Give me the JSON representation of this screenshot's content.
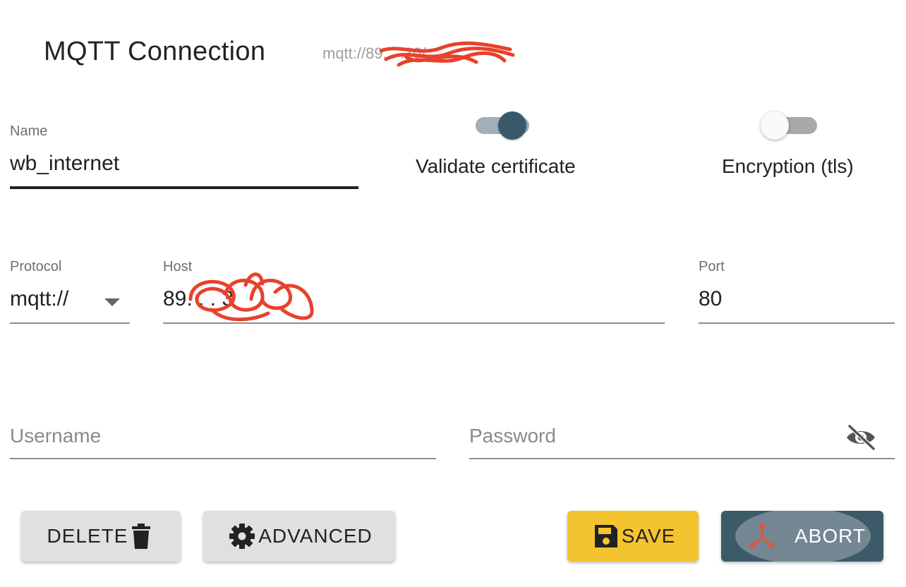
{
  "header": {
    "title": "MQTT Connection",
    "url": "mqtt://89.    .     .30/"
  },
  "name_field": {
    "label": "Name",
    "value": "wb_internet"
  },
  "toggles": {
    "validate_certificate": {
      "label": "Validate certificate",
      "checked": true
    },
    "encryption": {
      "label": "Encryption (tls)",
      "checked": false
    }
  },
  "protocol": {
    "label": "Protocol",
    "value": "mqtt://"
  },
  "host": {
    "label": "Host",
    "value": "89.   .   .   3"
  },
  "port": {
    "label": "Port",
    "value": "80"
  },
  "username": {
    "placeholder": "Username"
  },
  "password": {
    "placeholder": "Password"
  },
  "buttons": {
    "delete": "DELETE",
    "advanced": "ADVANCED",
    "save": "SAVE",
    "abort": "ABORT"
  },
  "icons": {
    "delete": "trash-icon",
    "advanced": "gear-icon",
    "save": "floppy-disk-icon",
    "abort": "fork-icon",
    "password_visibility": "eye-off-icon"
  },
  "colors": {
    "save": "#f4c430",
    "abort": "#3d5a68",
    "toggle_on": "#37596b",
    "redaction": "#e8412c"
  }
}
